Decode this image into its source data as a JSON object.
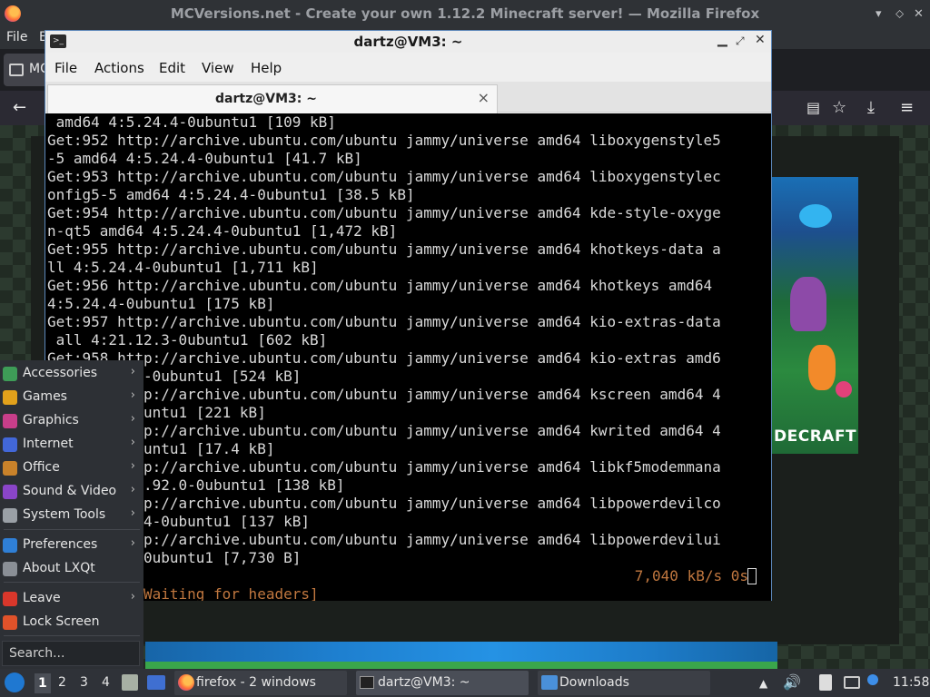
{
  "firefox": {
    "window_title": "MCVersions.net - Create your own 1.12.2 Minecraft server! — Mozilla Firefox",
    "menu": [
      "File",
      "E"
    ],
    "tab_label": "MC",
    "banner_text": "DECRAFT"
  },
  "terminal": {
    "window_title": "dartz@VM3: ~",
    "menu": [
      "File",
      "Actions",
      "Edit",
      "View",
      "Help"
    ],
    "tab_label": "dartz@VM3: ~",
    "lines": [
      " amd64 4:5.24.4-0ubuntu1 [109 kB]",
      "Get:952 http://archive.ubuntu.com/ubuntu jammy/universe amd64 liboxygenstyle5",
      "-5 amd64 4:5.24.4-0ubuntu1 [41.7 kB]",
      "Get:953 http://archive.ubuntu.com/ubuntu jammy/universe amd64 liboxygenstylec",
      "onfig5-5 amd64 4:5.24.4-0ubuntu1 [38.5 kB]",
      "Get:954 http://archive.ubuntu.com/ubuntu jammy/universe amd64 kde-style-oxyge",
      "n-qt5 amd64 4:5.24.4-0ubuntu1 [1,472 kB]",
      "Get:955 http://archive.ubuntu.com/ubuntu jammy/universe amd64 khotkeys-data a",
      "ll 4:5.24.4-0ubuntu1 [1,711 kB]",
      "Get:956 http://archive.ubuntu.com/ubuntu jammy/universe amd64 khotkeys amd64",
      "4:5.24.4-0ubuntu1 [175 kB]",
      "Get:957 http://archive.ubuntu.com/ubuntu jammy/universe amd64 kio-extras-data",
      " all 4:21.12.3-0ubuntu1 [602 kB]",
      "Get:958 http://archive.ubuntu.com/ubuntu jammy/universe amd64 kio-extras amd6",
      "4 4:21.12.3-0ubuntu1 [524 kB]",
      "Get:959 http://archive.ubuntu.com/ubuntu jammy/universe amd64 kscreen amd64 4",
      ":5.24.4-0ubuntu1 [221 kB]",
      "Get:960 http://archive.ubuntu.com/ubuntu jammy/universe amd64 kwrited amd64 4",
      ":5.24.4-0ubuntu1 [17.4 kB]",
      "Get:961 http://archive.ubuntu.com/ubuntu jammy/universe amd64 libkf5modemmana",
      "ger amd64 5.92.0-0ubuntu1 [138 kB]",
      "Get:962 http://archive.ubuntu.com/ubuntu jammy/universe amd64 libpowerdevilco",
      "re2 4:5.24.4-0ubuntu1 [137 kB]",
      "Get:963 http://archive.ubuntu.com/ubuntu jammy/universe amd64 libpowerdevilui",
      "5 4:5.24.4-0ubuntu1 [7,730 B]"
    ],
    "status_left": "99% [Waiting for headers]",
    "status_right": "7,040 kB/s 0s"
  },
  "app_menu": {
    "items": [
      {
        "label": "Accessories",
        "icon": "accessories-icon",
        "color": "#3e9c57"
      },
      {
        "label": "Games",
        "icon": "games-icon",
        "color": "#e2a11b"
      },
      {
        "label": "Graphics",
        "icon": "graphics-icon",
        "color": "#c83e8a"
      },
      {
        "label": "Internet",
        "icon": "internet-icon",
        "color": "#4267d8"
      },
      {
        "label": "Office",
        "icon": "office-icon",
        "color": "#c9822a"
      },
      {
        "label": "Sound & Video",
        "icon": "sound-video-icon",
        "color": "#8a45c9"
      },
      {
        "label": "System Tools",
        "icon": "system-tools-icon",
        "color": "#9aa0a6"
      },
      {
        "label": "Preferences",
        "icon": "preferences-icon",
        "color": "#2f7fd6"
      },
      {
        "label": "About LXQt",
        "icon": "about-icon",
        "color": "#8a8f96"
      },
      {
        "label": "Leave",
        "icon": "leave-icon",
        "color": "#d9372b"
      },
      {
        "label": "Lock Screen",
        "icon": "lock-icon",
        "color": "#e0522a"
      }
    ],
    "search_placeholder": "Search..."
  },
  "taskbar": {
    "workspaces": [
      "1",
      "2",
      "3",
      "4"
    ],
    "active_workspace": "1",
    "tasks": [
      "firefox - 2 windows",
      "dartz@VM3: ~",
      "Downloads"
    ],
    "clock": "11:58"
  }
}
